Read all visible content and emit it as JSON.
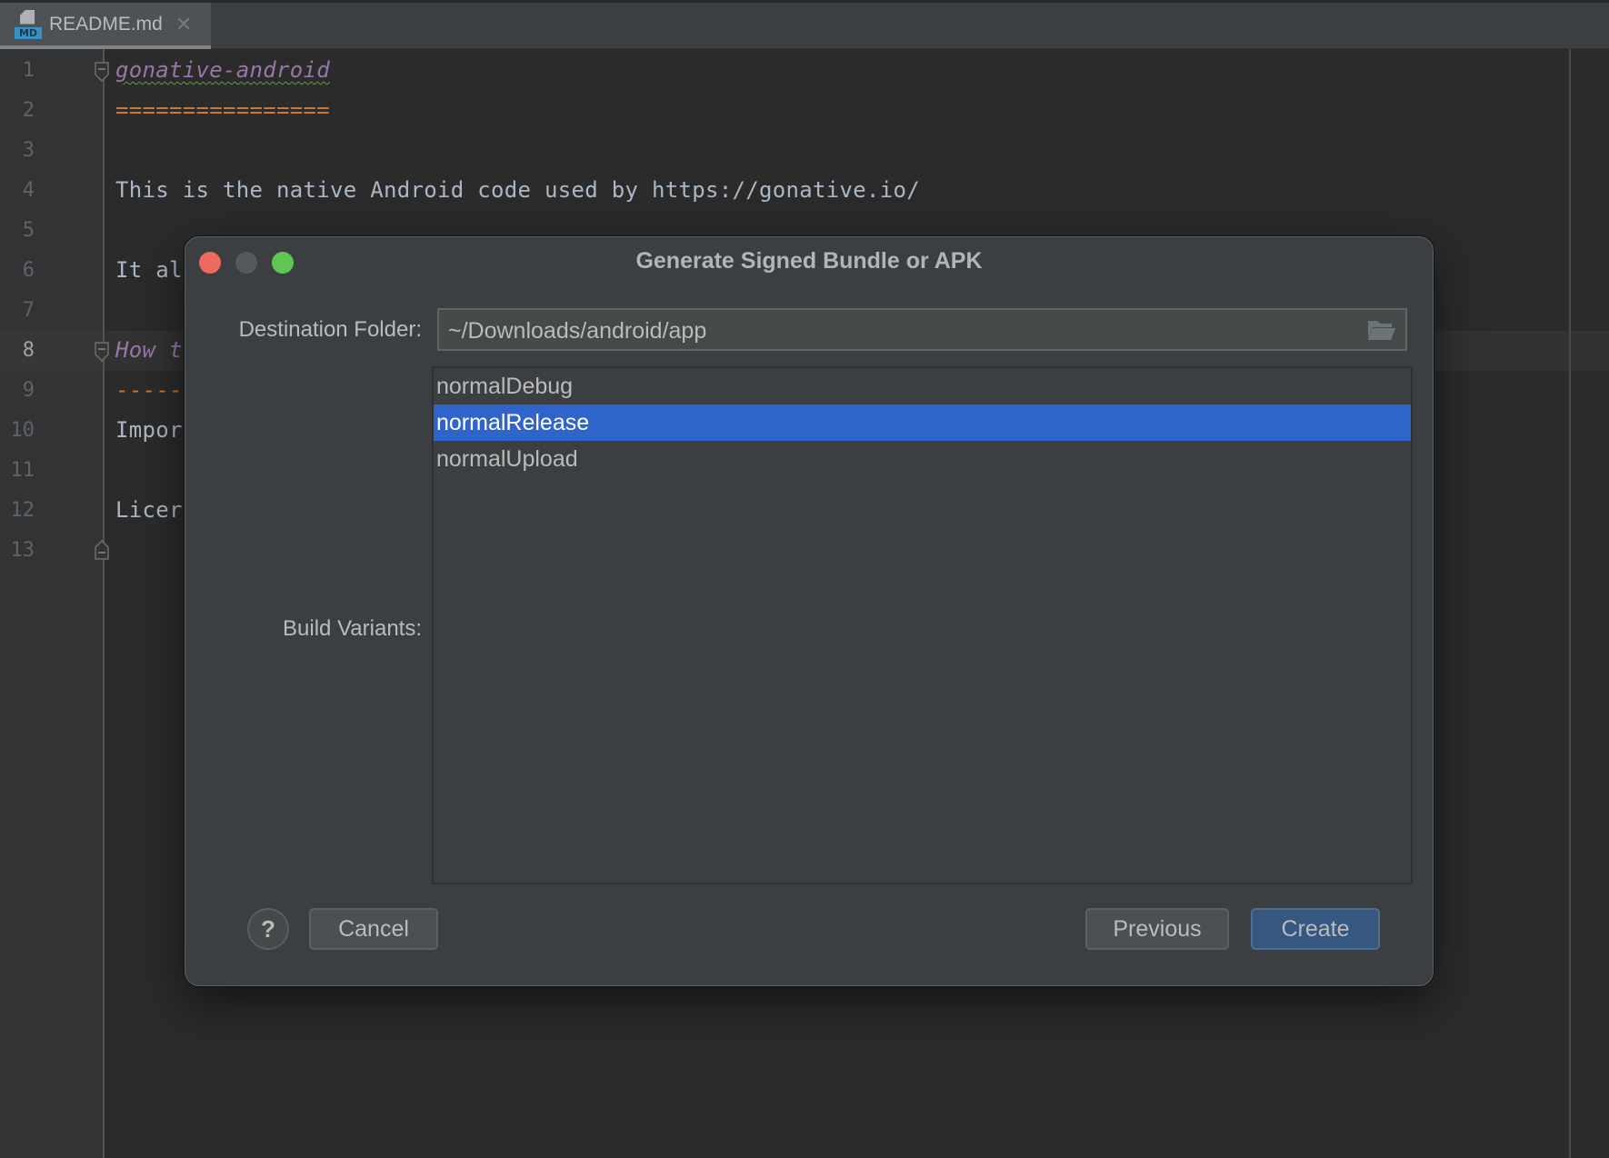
{
  "editor": {
    "tab": {
      "icon": "markdown-file-icon",
      "badge": "MD",
      "label": "README.md",
      "close": "✕"
    },
    "current_line": 8,
    "lines": [
      {
        "n": "1",
        "text": "gonative-android"
      },
      {
        "n": "2",
        "text": "================"
      },
      {
        "n": "3",
        "text": ""
      },
      {
        "n": "4",
        "text": "This is the native Android code used by https://gonative.io/"
      },
      {
        "n": "5",
        "text": ""
      },
      {
        "n": "6",
        "text": "It al"
      },
      {
        "n": "7",
        "text": ""
      },
      {
        "n": "8",
        "text": "How t"
      },
      {
        "n": "9",
        "text": "-----"
      },
      {
        "n": "10",
        "text": "Impor"
      },
      {
        "n": "11",
        "text": ""
      },
      {
        "n": "12",
        "text": "Licer"
      },
      {
        "n": "13",
        "text": ""
      }
    ]
  },
  "dialog": {
    "title": "Generate Signed Bundle or APK",
    "destination_label": "Destination Folder:",
    "destination_value": "~/Downloads/android/app",
    "folder_icon": "folder-open-icon",
    "build_variants_label": "Build Variants:",
    "variants": [
      {
        "label": "normalDebug",
        "selected": false
      },
      {
        "label": "normalRelease",
        "selected": true
      },
      {
        "label": "normalUpload",
        "selected": false
      }
    ],
    "help_label": "?",
    "cancel_label": "Cancel",
    "previous_label": "Previous",
    "create_label": "Create"
  },
  "colors": {
    "selection": "#2f65ca",
    "primary_button": "#365880",
    "traffic_close": "#ec6a5e",
    "traffic_max": "#61c554",
    "heading": "#9876aa",
    "underline": "#cc7832"
  }
}
